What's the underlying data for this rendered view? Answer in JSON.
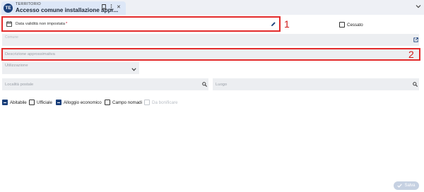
{
  "tab": {
    "icon_text": "TE",
    "kicker": "TERRITORIO",
    "title": "Accesso comune installazione appr...",
    "bookmark_icon": "bookmark-icon",
    "more_icon": "more-vert-icon",
    "close_label": "✕"
  },
  "form": {
    "validity_text": "Data validità non impostata",
    "required_mark": "*",
    "annotation_1": "1",
    "annotation_2": "2",
    "cessato_label": "Cessato",
    "comune_label": "Comune",
    "descrizione_placeholder": "Descrizione approssimativa",
    "utilizzazione_label": "Utilizzazione",
    "localita_label": "Località postale",
    "luogo_label": "Luogo",
    "checkboxes": [
      {
        "label": "Abitabile",
        "checked": true,
        "disabled": false
      },
      {
        "label": "Ufficiale",
        "checked": false,
        "disabled": false
      },
      {
        "label": "Alloggio economico",
        "checked": true,
        "disabled": false
      },
      {
        "label": "Campo nomadi",
        "checked": false,
        "disabled": false
      },
      {
        "label": "Da bonificare",
        "checked": false,
        "disabled": true
      }
    ]
  },
  "footer": {
    "save_label": "Salva"
  },
  "colors": {
    "accent": "#1a3f7a",
    "annotation": "#e32b2b",
    "field_bg": "#eceef1"
  }
}
